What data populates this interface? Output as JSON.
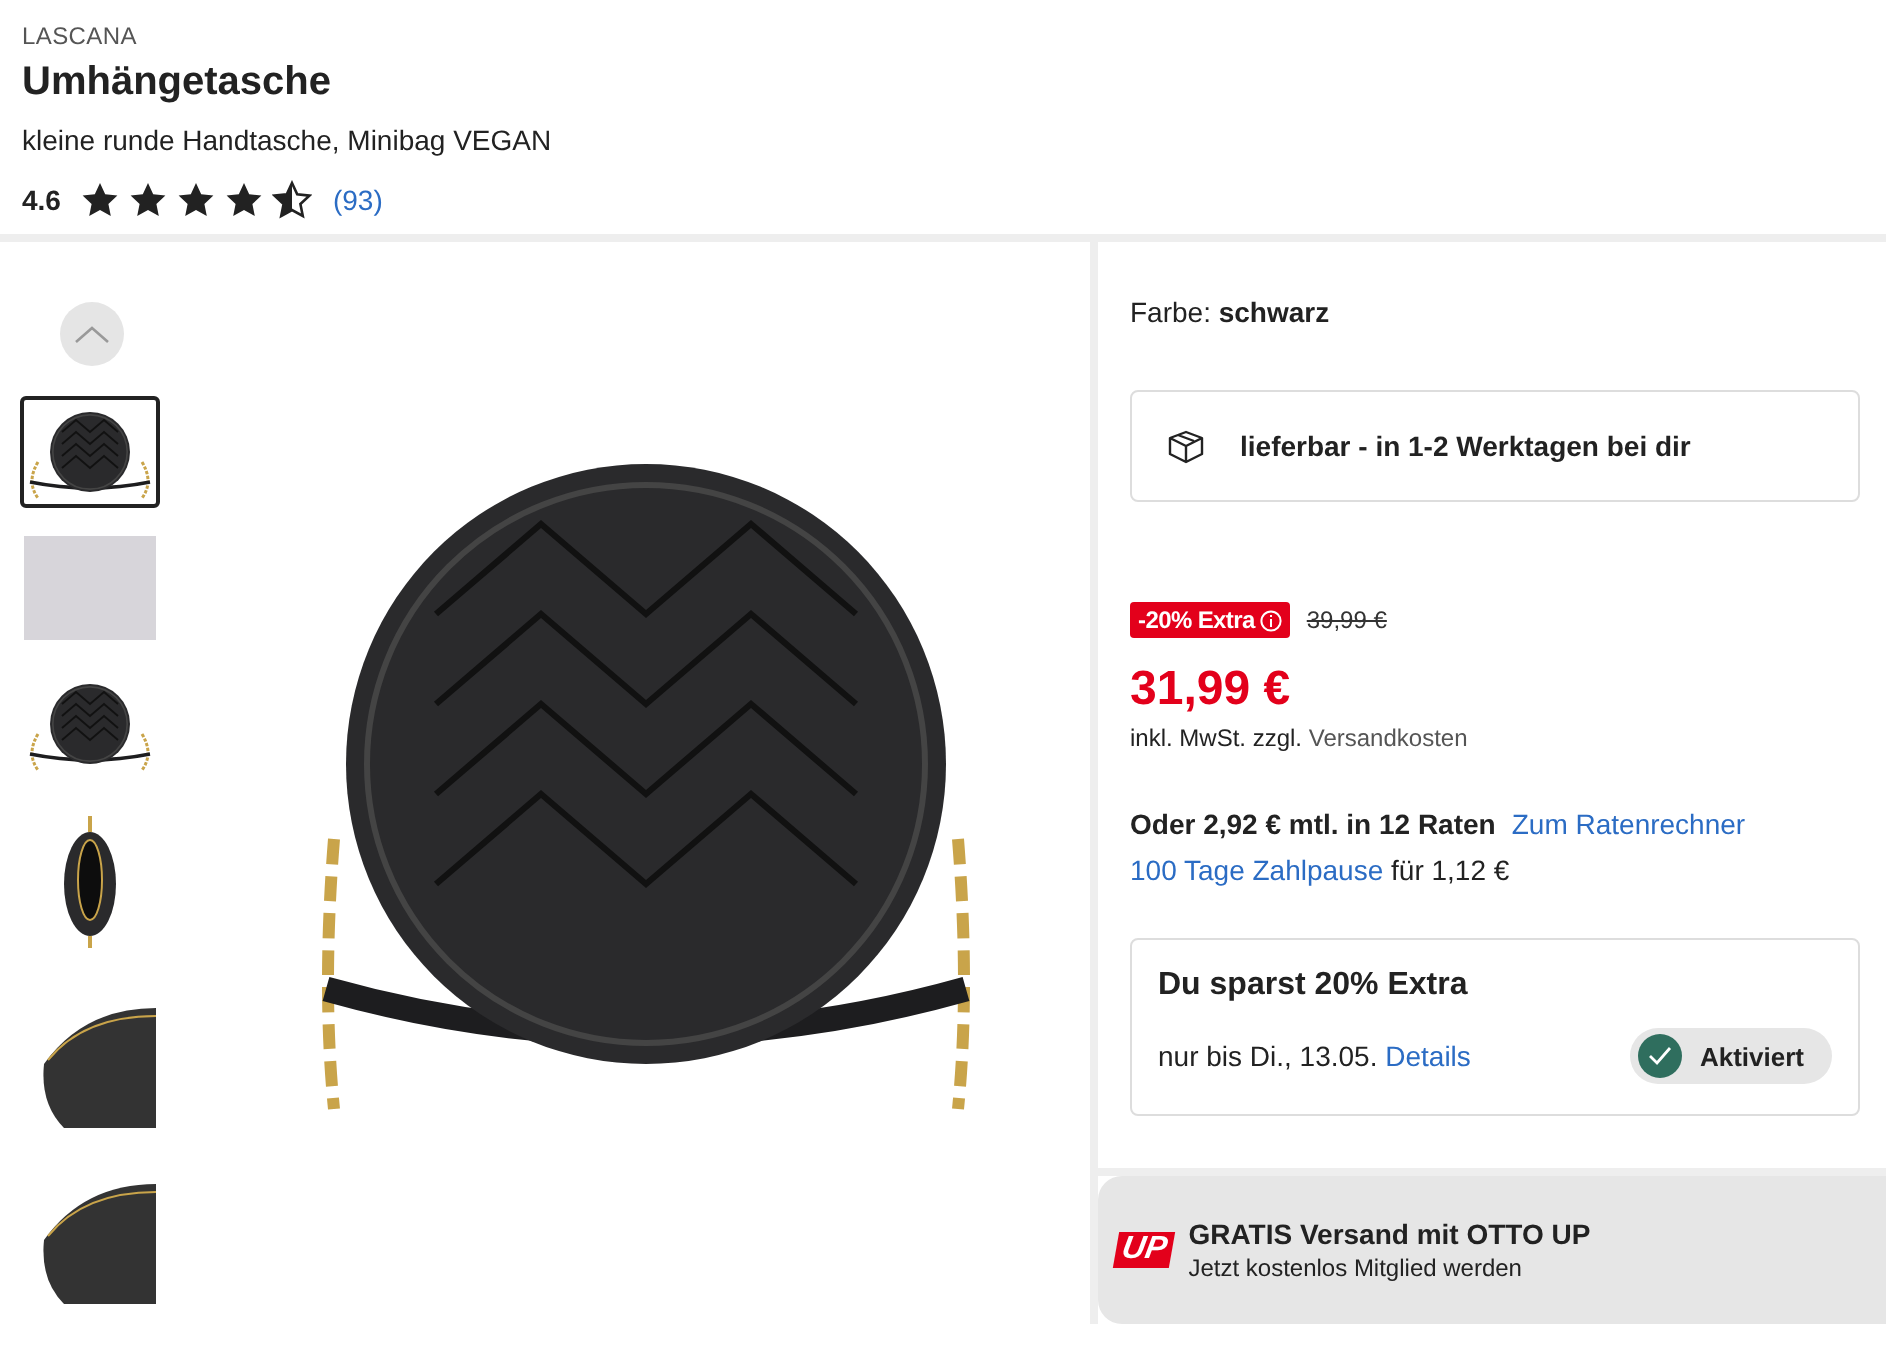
{
  "brand": "LASCANA",
  "title": "Umhängetasche",
  "subtitle": "kleine runde Handtasche, Minibag VEGAN",
  "rating": {
    "value": "4.6",
    "stars": 4.5,
    "count": "(93)"
  },
  "gallery": {
    "thumbnails": [
      {
        "kind": "bag",
        "selected": true
      },
      {
        "kind": "photo",
        "selected": false
      },
      {
        "kind": "bag",
        "selected": false
      },
      {
        "kind": "open",
        "selected": false
      },
      {
        "kind": "closeup",
        "selected": false
      },
      {
        "kind": "closeup",
        "selected": false
      }
    ]
  },
  "color": {
    "label": "Farbe:",
    "value": "schwarz"
  },
  "delivery": "lieferbar - in 1-2 Werktagen bei dir",
  "price": {
    "badge": "-20% Extra",
    "old": "39,99 €",
    "current": "31,99 €",
    "tax_note": "inkl. MwSt. zzgl.",
    "shipping_link": "Versandkosten"
  },
  "installments": {
    "text": "Oder 2,92 € mtl. in 12 Raten",
    "link": "Zum Ratenrechner",
    "pause_link": "100 Tage Zahlpause",
    "pause_text": "für 1,12 €"
  },
  "savings": {
    "title": "Du sparst 20% Extra",
    "text": "nur bis Di., 13.05.",
    "link": "Details",
    "toggle": {
      "label": "Aktiviert",
      "on": true
    }
  },
  "promo": {
    "logo": "UP",
    "title": "GRATIS Versand mit OTTO UP",
    "subtitle": "Jetzt kostenlos Mitglied werden"
  }
}
